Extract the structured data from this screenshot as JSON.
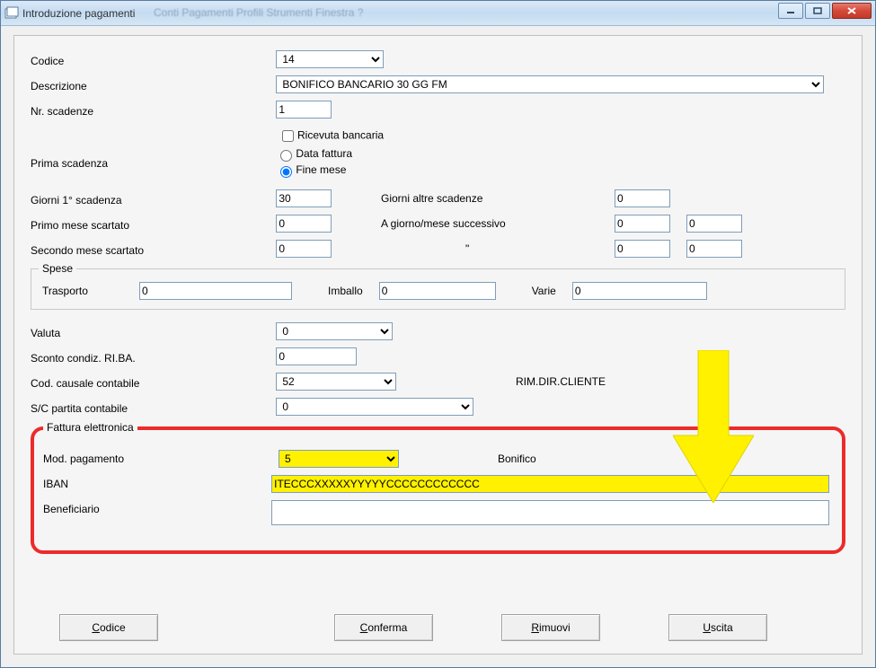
{
  "window": {
    "title": "Introduzione pagamenti",
    "blurredMenu": "Conti   Pagamenti   Profili   Strumenti   Finestra   ?"
  },
  "labels": {
    "codice": "Codice",
    "descrizione": "Descrizione",
    "nrscadenze": "Nr. scadenze",
    "ricbancaria": "Ricevuta bancaria",
    "datafattura": "Data fattura",
    "finemese": "Fine mese",
    "primascadenza": "Prima scadenza",
    "giorni1": "Giorni 1° scadenza",
    "giornialt": "Giorni altre scadenze",
    "primomese": "Primo mese scartato",
    "agiorno": "A giorno/mese successivo",
    "secmese": "Secondo mese scartato",
    "ditto": "\"",
    "spese": "Spese",
    "trasporto": "Trasporto",
    "imballo": "Imballo",
    "varie": "Varie",
    "valuta": "Valuta",
    "sconto": "Sconto condiz. RI.BA.",
    "codcaus": "Cod. causale contabile",
    "rimdir": "RIM.DIR.CLIENTE",
    "sc": "S/C partita contabile",
    "fattel": "Fattura elettronica",
    "modpag": "Mod. pagamento",
    "bonifico": "Bonifico",
    "iban": "IBAN",
    "benef": "Beneficiario"
  },
  "values": {
    "codice": "14",
    "descrizione": "BONIFICO BANCARIO 30 GG FM",
    "nrscadenze": "1",
    "ricbancaria_checked": false,
    "prima_radio": "finemese",
    "giorni1": "30",
    "giornialt": "0",
    "primomese": "0",
    "agiorno_a": "0",
    "agiorno_b": "0",
    "secmese": "0",
    "ditto_a": "0",
    "ditto_b": "0",
    "trasporto": "0",
    "imballo": "0",
    "varie": "0",
    "valuta": "0",
    "sconto": "0",
    "codcaus": "52",
    "sc": "0",
    "modpag": "5",
    "iban": "ITECCCXXXXXYYYYYCCCCCCCCCCCC",
    "benef": ""
  },
  "buttons": {
    "codice": "Codice",
    "conferma": "Conferma",
    "rimuovi": "Rimuovi",
    "uscita": "Uscita"
  }
}
